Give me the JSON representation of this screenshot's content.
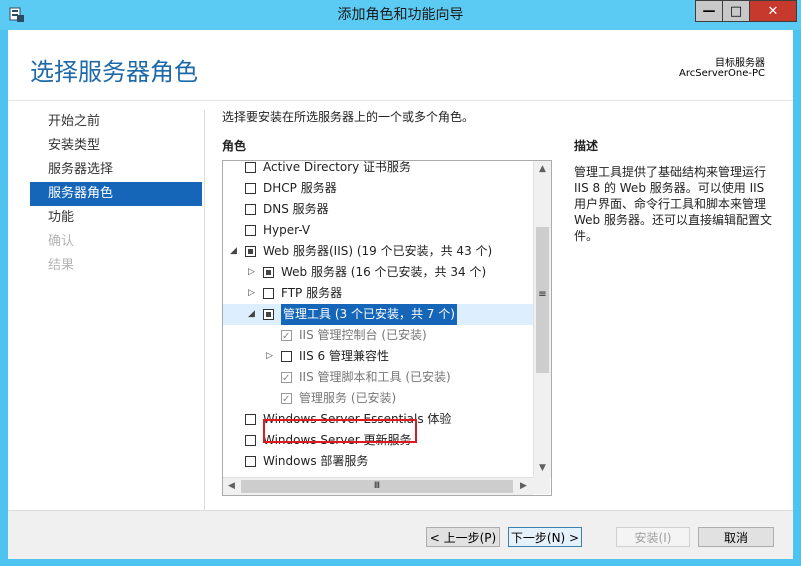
{
  "window": {
    "title": "添加角色和功能向导",
    "minimize_label": "—",
    "maximize_label": "□",
    "close_label": "✕"
  },
  "header": {
    "page_title": "选择服务器角色",
    "target_label": "目标服务器",
    "target_value": "ArcServerOne-PC"
  },
  "nav": {
    "items": [
      {
        "label": "开始之前",
        "state": "normal"
      },
      {
        "label": "安装类型",
        "state": "normal"
      },
      {
        "label": "服务器选择",
        "state": "normal"
      },
      {
        "label": "服务器角色",
        "state": "active"
      },
      {
        "label": "功能",
        "state": "normal"
      },
      {
        "label": "确认",
        "state": "disabled"
      },
      {
        "label": "结果",
        "state": "disabled"
      }
    ]
  },
  "content": {
    "instruction": "选择要安装在所选服务器上的一个或多个角色。",
    "roles_header": "角色",
    "description_header": "描述",
    "description": "管理工具提供了基础结构来管理运行 IIS 8 的 Web 服务器。可以使用 IIS 用户界面、命令行工具和脚本来管理 Web 服务器。还可以直接编辑配置文件。"
  },
  "roles": [
    {
      "label": "Active Directory 证书服务",
      "check": "none",
      "expander": "",
      "indent": 0,
      "grey": false
    },
    {
      "label": "DHCP 服务器",
      "check": "none",
      "expander": "",
      "indent": 0,
      "grey": false
    },
    {
      "label": "DNS 服务器",
      "check": "none",
      "expander": "",
      "indent": 0,
      "grey": false
    },
    {
      "label": "Hyper-V",
      "check": "none",
      "expander": "",
      "indent": 0,
      "grey": false
    },
    {
      "label": "Web 服务器(IIS) (19 个已安装，共 43 个)",
      "check": "partial",
      "expander": "◢",
      "indent": 0,
      "grey": false
    },
    {
      "label": "Web 服务器 (16 个已安装，共 34 个)",
      "check": "partial",
      "expander": "▷",
      "indent": 1,
      "grey": false
    },
    {
      "label": "FTP 服务器",
      "check": "none",
      "expander": "▷",
      "indent": 1,
      "grey": false
    },
    {
      "label": "管理工具 (3 个已安装，共 7 个)",
      "check": "partial",
      "expander": "◢",
      "indent": 1,
      "grey": false,
      "selected": true
    },
    {
      "label": "IIS 管理控制台 (已安装)",
      "check": "checked",
      "expander": "",
      "indent": 2,
      "grey": true
    },
    {
      "label": "IIS 6 管理兼容性",
      "check": "none",
      "expander": "▷",
      "indent": 2,
      "grey": false
    },
    {
      "label": "IIS 管理脚本和工具 (已安装)",
      "check": "checked",
      "expander": "",
      "indent": 2,
      "grey": true
    },
    {
      "label": "管理服务 (已安装)",
      "check": "checked",
      "expander": "",
      "indent": 2,
      "grey": true,
      "highlighted": true
    },
    {
      "label": "Windows Server Essentials 体验",
      "check": "none",
      "expander": "",
      "indent": 0,
      "grey": false
    },
    {
      "label": "Windows Server 更新服务",
      "check": "none",
      "expander": "",
      "indent": 0,
      "grey": false
    },
    {
      "label": "Windows 部署服务",
      "check": "none",
      "expander": "",
      "indent": 0,
      "grey": false
    }
  ],
  "scrollbars": {
    "up": "▲",
    "down": "▼",
    "left": "◀",
    "right": "▶",
    "vthumb_grip": "≡",
    "hthumb_grip": "Ⅲ"
  },
  "buttons": {
    "prev": "< 上一步(P)",
    "next": "下一步(N) >",
    "install": "安装(I)",
    "cancel": "取消"
  },
  "colors": {
    "title_bar": "#5ccbf3",
    "accent": "#1565b8",
    "highlight_box": "#e0191d"
  }
}
